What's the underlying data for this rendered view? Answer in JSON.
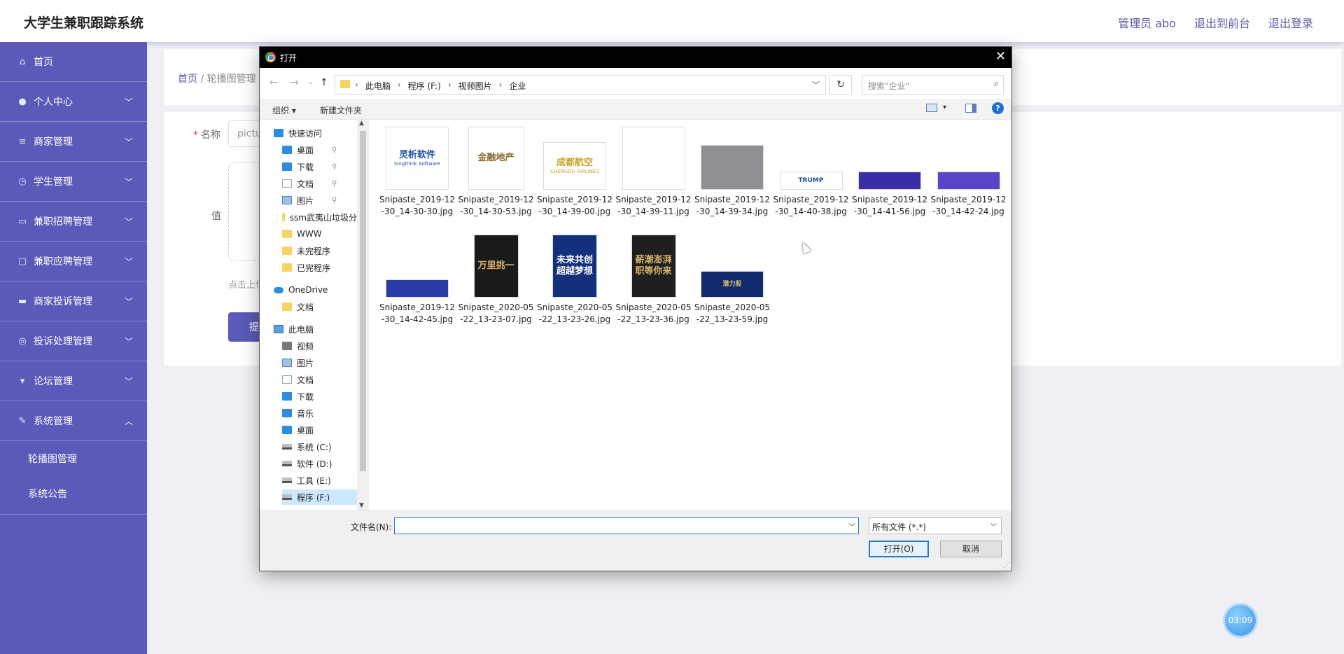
{
  "app": {
    "title": "大学生兼职跟踪系统",
    "top_links": [
      "管理员 abo",
      "退出到前台",
      "退出登录"
    ]
  },
  "sidebar": {
    "items": [
      {
        "label": "首页",
        "icon": "home-icon",
        "glyph": "⌂",
        "chevron": ""
      },
      {
        "label": "个人中心",
        "icon": "user-icon",
        "glyph": "●",
        "chevron": "﹀"
      },
      {
        "label": "商家管理",
        "icon": "list-icon",
        "glyph": "≡",
        "chevron": "﹀"
      },
      {
        "label": "学生管理",
        "icon": "clock-icon",
        "glyph": "◷",
        "chevron": "﹀"
      },
      {
        "label": "兼职招聘管理",
        "icon": "card-icon",
        "glyph": "▭",
        "chevron": "﹀"
      },
      {
        "label": "兼职应聘管理",
        "icon": "chat-icon",
        "glyph": "▢",
        "chevron": "﹀"
      },
      {
        "label": "商家投诉管理",
        "icon": "briefcase-icon",
        "glyph": "▬",
        "chevron": "﹀"
      },
      {
        "label": "投诉处理管理",
        "icon": "compass-icon",
        "glyph": "◎",
        "chevron": "﹀"
      },
      {
        "label": "论坛管理",
        "icon": "cup-icon",
        "glyph": "▾",
        "chevron": "﹀"
      },
      {
        "label": "系统管理",
        "icon": "pencil-icon",
        "glyph": "✎",
        "chevron": "︿"
      }
    ],
    "sub_items": [
      "轮播图管理",
      "系统公告"
    ]
  },
  "main": {
    "breadcrumb": [
      "首页",
      "轮播图管理"
    ],
    "form": {
      "name_label": "名称",
      "name_value": "pictu",
      "value_label": "值",
      "upload_tip": "点击上传",
      "submit_label": "提"
    }
  },
  "timer": "03:09",
  "dialog": {
    "title": "打开",
    "close": "✕",
    "nav_back": "←",
    "nav_forward": "→",
    "nav_recent": "⌄",
    "nav_up": "↑",
    "address": [
      "此电脑",
      "程序 (F:)",
      "视频图片",
      "企业"
    ],
    "search_placeholder": "搜索\"企业\"",
    "toolbar": {
      "organize": "组织 ▾",
      "new_folder": "新建文件夹"
    },
    "nav_pane": {
      "quick_access": "快速访问",
      "quick_items": [
        {
          "label": "桌面",
          "icon": "ic-blue",
          "pinned": true
        },
        {
          "label": "下载",
          "icon": "ic-blue",
          "pinned": true
        },
        {
          "label": "文档",
          "icon": "ic-doc",
          "pinned": true
        },
        {
          "label": "图片",
          "icon": "ic-pic",
          "pinned": true
        },
        {
          "label": "ssm武夷山垃圾分",
          "icon": "ic-folder",
          "pinned": false
        },
        {
          "label": "WWW",
          "icon": "ic-folder",
          "pinned": false
        },
        {
          "label": "未完程序",
          "icon": "ic-folder",
          "pinned": false
        },
        {
          "label": "已完程序",
          "icon": "ic-folder",
          "pinned": false
        }
      ],
      "onedrive": "OneDrive",
      "onedrive_items": [
        "文档"
      ],
      "this_pc": "此电脑",
      "pc_items": [
        {
          "label": "视频",
          "icon": "ic-vid"
        },
        {
          "label": "图片",
          "icon": "ic-pic"
        },
        {
          "label": "文档",
          "icon": "ic-doc"
        },
        {
          "label": "下载",
          "icon": "ic-blue"
        },
        {
          "label": "音乐",
          "icon": "ic-blue"
        },
        {
          "label": "桌面",
          "icon": "ic-blue"
        },
        {
          "label": "系统 (C:)",
          "icon": "ic-drive"
        },
        {
          "label": "软件 (D:)",
          "icon": "ic-drive"
        },
        {
          "label": "工具 (E:)",
          "icon": "ic-drive"
        },
        {
          "label": "程序 (F:)",
          "icon": "ic-drive"
        }
      ],
      "selected": "程序 (F:)"
    },
    "files": [
      {
        "name": "Snipaste_2019-12-30_14-30-30.jpg",
        "thumb_text": "灵析软件",
        "thumb_sub": "longthink Software",
        "bg": "#ffffff",
        "fg": "#1a4fa0"
      },
      {
        "name": "Snipaste_2019-12-30_14-30-53.jpg",
        "thumb_text": "金融地产",
        "thumb_sub": "",
        "bg": "#ffffff",
        "fg": "#8a6a2a"
      },
      {
        "name": "Snipaste_2019-12-30_14-39-00.jpg",
        "thumb_text": "成都航空",
        "thumb_sub": "CHENGDU AIRLINES",
        "bg": "#ffffff",
        "fg": "#c9a227"
      },
      {
        "name": "Snipaste_2019-12-30_14-39-11.jpg",
        "thumb_text": "",
        "thumb_sub": "",
        "bg": "#ffffff",
        "fg": "#c42a3a"
      },
      {
        "name": "Snipaste_2019-12-30_14-39-34.jpg",
        "thumb_text": "",
        "thumb_sub": "",
        "bg": "#8f8f95",
        "fg": "#ffffff"
      },
      {
        "name": "Snipaste_2019-12-30_14-40-38.jpg",
        "thumb_text": "TRUMP",
        "thumb_sub": "",
        "bg": "#ffffff",
        "fg": "#1a4fa0"
      },
      {
        "name": "Snipaste_2019-12-30_14-41-56.jpg",
        "thumb_text": "",
        "thumb_sub": "",
        "bg": "#3a2ea8",
        "fg": "#ffffff"
      },
      {
        "name": "Snipaste_2019-12-30_14-42-24.jpg",
        "thumb_text": "",
        "thumb_sub": "",
        "bg": "#5a44c8",
        "fg": "#ffffff"
      },
      {
        "name": "Snipaste_2019-12-30_14-42-45.jpg",
        "thumb_text": "",
        "thumb_sub": "",
        "bg": "#2a3ca8",
        "fg": "#ffffff"
      },
      {
        "name": "Snipaste_2020-05-22_13-23-07.jpg",
        "thumb_text": "万里挑一",
        "thumb_sub": "",
        "bg": "#1a1a1a",
        "fg": "#d9b36a"
      },
      {
        "name": "Snipaste_2020-05-22_13-23-26.jpg",
        "thumb_text": "未来共创 超越梦想",
        "thumb_sub": "",
        "bg": "#13307a",
        "fg": "#ffffff"
      },
      {
        "name": "Snipaste_2020-05-22_13-23-36.jpg",
        "thumb_text": "薪潮澎湃 职等你来",
        "thumb_sub": "",
        "bg": "#1f1f1f",
        "fg": "#d9b36a"
      },
      {
        "name": "Snipaste_2020-05-22_13-23-59.jpg",
        "thumb_text": "潜力股",
        "thumb_sub": "",
        "bg": "#0f2a6e",
        "fg": "#e0c070"
      }
    ],
    "filename_label": "文件名(N):",
    "filename_value": "",
    "filetype": "所有文件 (*.*)",
    "open_label": "打开(O)",
    "cancel_label": "取消",
    "help": "?"
  }
}
